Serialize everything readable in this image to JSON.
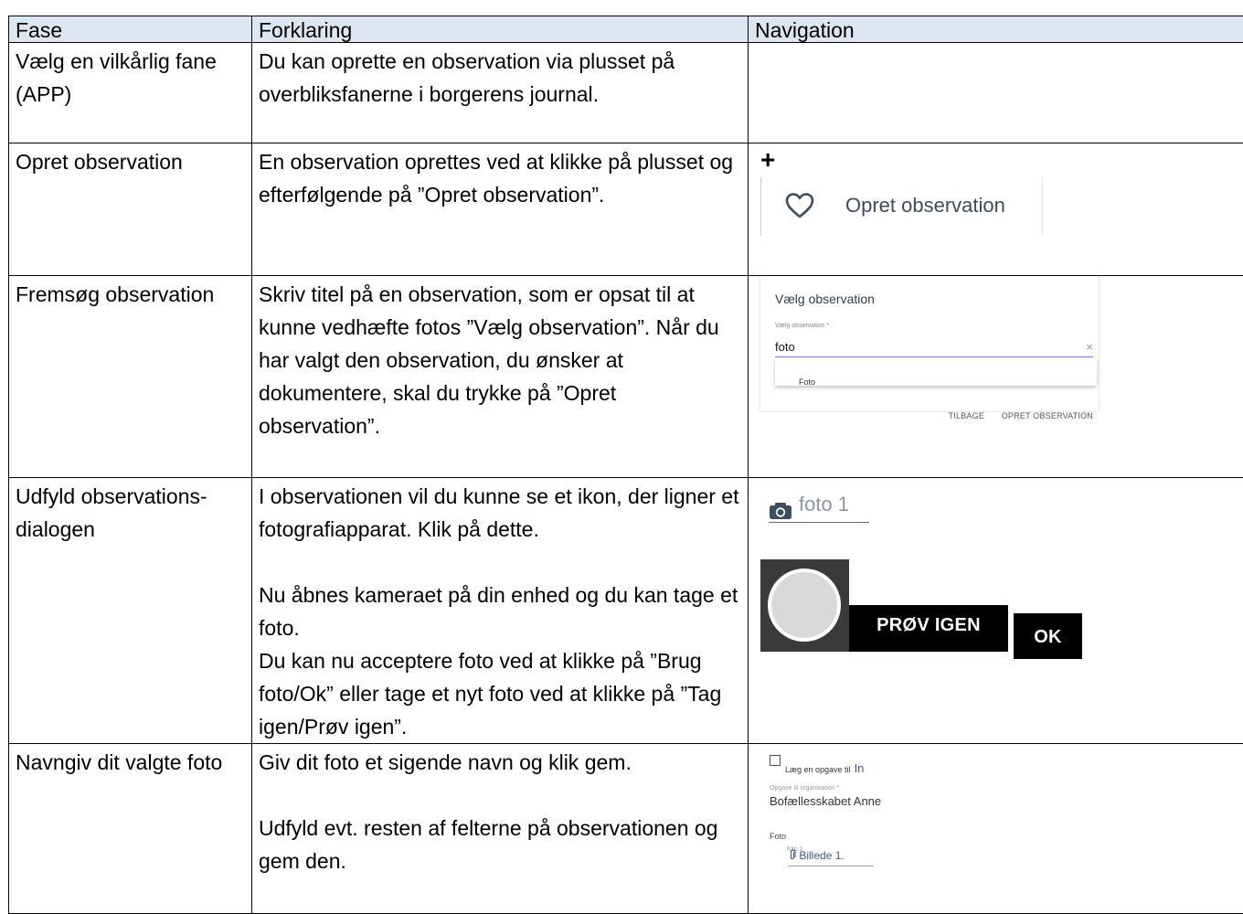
{
  "table": {
    "headers": {
      "fase": "Fase",
      "forklaring": "Forklaring",
      "navigation": "Navigation"
    },
    "rows": [
      {
        "fase": "Vælg en vilkårlig fane (APP)",
        "forklaring": "Du kan oprette en observation via plusset på overbliksfanerne i borgerens journal."
      },
      {
        "fase": "Opret observation",
        "forklaring": "En observation oprettes ved at klikke på plusset og efterfølgende på ”Opret observation”.",
        "nav": {
          "plus": "+",
          "button_label": "Opret observation",
          "icon": "heart-icon"
        }
      },
      {
        "fase": "Fremsøg observation",
        "forklaring": "Skriv titel på en observation, som er opsat til at kunne vedhæfte fotos ”Vælg observation”. Når du har valgt den observation, du ønsker at dokumentere, skal du trykke på ”Opret observation”.",
        "nav": {
          "dialog_title": "Vælg observation",
          "field_label": "Vælg observation *",
          "field_value": "foto",
          "clear": "×",
          "option": "Foto",
          "back_button": "TILBAGE",
          "create_button": "OPRET OBSERVATION"
        }
      },
      {
        "fase": "Udfyld observations-dialogen",
        "forklaring_p1": "I observationen vil du kunne se et ikon, der ligner et fotografiapparat. Klik på dette.",
        "forklaring_p2": "Nu åbnes kameraet på din enhed og du kan tage et foto.",
        "forklaring_p3": "Du kan nu acceptere foto ved at klikke på ”Brug foto/Ok” eller tage et nyt foto ved at klikke på ”Tag igen/Prøv igen”.",
        "nav": {
          "foto_label": "foto 1",
          "icon": "camera-icon",
          "retry_button": "PRØV IGEN",
          "ok_button": "OK"
        }
      },
      {
        "fase": "Navngiv dit valgte foto",
        "forklaring_p1": "Giv dit foto et sigende navn og klik gem.",
        "forklaring_p2": "Udfyld evt. resten af felterne på observationen og gem den.",
        "nav": {
          "checkbox_label": "Læg en opgave til",
          "checkbox_suffix": "In",
          "org_label": "Opgave til organisation *",
          "org_value": "Bofællesskabet Anne",
          "foto_section": "Foto",
          "foto_sub": "foto 1",
          "attachment": "Billede 1.",
          "icon": "paperclip-icon"
        }
      }
    ]
  }
}
